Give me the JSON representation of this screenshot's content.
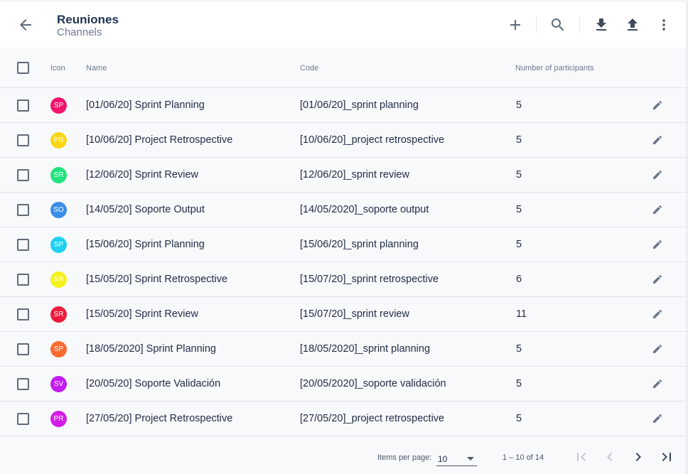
{
  "header": {
    "title": "Reuniones",
    "subtitle": "Channels"
  },
  "table": {
    "columns": {
      "icon": "Icon",
      "name": "Name",
      "code": "Code",
      "participants": "Number of participants"
    },
    "rows": [
      {
        "initials": "SP",
        "color": "#f0146c",
        "name": "[01/06/20] Sprint Planning",
        "code": "[01/06/20]_sprint planning",
        "participants": "5"
      },
      {
        "initials": "PR",
        "color": "#f9d614",
        "name": "[10/06/20] Project Retrospective",
        "code": "[10/06/20]_project retrospective",
        "participants": "5"
      },
      {
        "initials": "SR",
        "color": "#21e27e",
        "name": "[12/06/20] Sprint Review",
        "code": "[12/06/20]_sprint review",
        "participants": "5"
      },
      {
        "initials": "SO",
        "color": "#3a8ee6",
        "name": "[14/05/20] Soporte Output",
        "code": "[14/05/2020]_soporte output",
        "participants": "5"
      },
      {
        "initials": "SP",
        "color": "#1fd0f0",
        "name": "[15/06/20] Sprint Planning",
        "code": "[15/06/20]_sprint planning",
        "participants": "5"
      },
      {
        "initials": "SR",
        "color": "#f4f01c",
        "name": "[15/05/20] Sprint Retrospective",
        "code": "[15/07/20]_sprint retrospective",
        "participants": "6"
      },
      {
        "initials": "SR",
        "color": "#ee1c3c",
        "name": "[15/05/20] Sprint Review",
        "code": "[15/07/20]_sprint review",
        "participants": "11"
      },
      {
        "initials": "SP",
        "color": "#f86a2e",
        "name": "[18/05/2020] Sprint Planning",
        "code": "[18/05/2020]_sprint planning",
        "participants": "5"
      },
      {
        "initials": "SV",
        "color": "#c21cf0",
        "name": "[20/05/20] Soporte Validación",
        "code": "[20/05/2020]_soporte validación",
        "participants": "5"
      },
      {
        "initials": "PR",
        "color": "#d21ce6",
        "name": "[27/05/20] Project Retrospective",
        "code": "[27/05/20]_project retrospective",
        "participants": "5"
      }
    ]
  },
  "paginator": {
    "items_per_page_label": "Items per page:",
    "items_per_page_value": "10",
    "range_label": "1 – 10 of 14"
  },
  "icons": {
    "back": "arrow-back-icon",
    "add": "plus-icon",
    "search": "search-icon",
    "download": "download-icon",
    "upload": "upload-icon",
    "more": "more-vert-icon",
    "edit": "pencil-icon",
    "first": "first-page-icon",
    "prev": "chevron-left-icon",
    "next": "chevron-right-icon",
    "last": "last-page-icon"
  }
}
